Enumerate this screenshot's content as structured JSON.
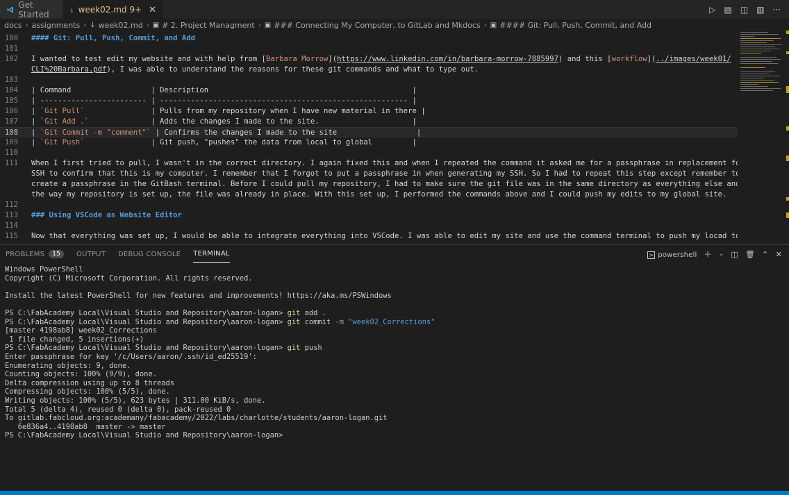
{
  "tabs": [
    {
      "label": "Get Started",
      "active": false,
      "icon": "vscode-icon"
    },
    {
      "label": "week02.md",
      "modified_marker": "9+",
      "active": true,
      "icon": "markdown-icon"
    }
  ],
  "breadcrumb": [
    {
      "label": "docs"
    },
    {
      "label": "assignments"
    },
    {
      "label": "week02.md",
      "icon": "markdown-icon"
    },
    {
      "label": "# 2. Project Managment",
      "icon": "symbol-icon"
    },
    {
      "label": "### Connecting My Computer, to GitLab and Mkdocs",
      "icon": "symbol-icon"
    },
    {
      "label": "#### Git: Pull, Push, Commit, and Add",
      "icon": "symbol-icon"
    }
  ],
  "editor": {
    "current_line": "108",
    "lines": [
      {
        "n": "100",
        "parts": [
          {
            "t": "#### Git: Pull, Push, Commit, and Add",
            "c": "heading"
          }
        ]
      },
      {
        "n": "101",
        "parts": []
      },
      {
        "n": "102",
        "parts": [
          {
            "t": "I wanted to test edit my website and with help from [",
            "c": ""
          },
          {
            "t": "Barbara Morrow",
            "c": "link-text"
          },
          {
            "t": "](",
            "c": ""
          },
          {
            "t": "https://www.linkedin.com/in/barbara-morrow-7885997",
            "c": "link-url"
          },
          {
            "t": ") and this [",
            "c": ""
          },
          {
            "t": "workflow",
            "c": "link-text"
          },
          {
            "t": "](",
            "c": ""
          },
          {
            "t": "../images/week01/",
            "c": "link-url"
          }
        ]
      },
      {
        "n": "",
        "parts": [
          {
            "t": "CLI%20Barbara.pdf",
            "c": "link-url"
          },
          {
            "t": "), I was able to understand the reasons for these git commands and what to type out.",
            "c": ""
          }
        ]
      },
      {
        "n": "103",
        "parts": []
      },
      {
        "n": "104",
        "parts": [
          {
            "t": "| Command                  | Description                                              |",
            "c": ""
          }
        ]
      },
      {
        "n": "105",
        "parts": [
          {
            "t": "| ------------------------ | -------------------------------------------------------- |",
            "c": ""
          }
        ]
      },
      {
        "n": "106",
        "parts": [
          {
            "t": "| ",
            "c": ""
          },
          {
            "t": "`Git Pull`",
            "c": "inline-code"
          },
          {
            "t": "               | Pulls from my repository when I have new material in there |",
            "c": ""
          }
        ]
      },
      {
        "n": "107",
        "parts": [
          {
            "t": "| ",
            "c": ""
          },
          {
            "t": "`Git Add .`",
            "c": "inline-code"
          },
          {
            "t": "              | Adds the changes I made to the site.                     |",
            "c": ""
          }
        ]
      },
      {
        "n": "108",
        "parts": [
          {
            "t": "| ",
            "c": ""
          },
          {
            "t": "`Git Commit -m \"comment\"`",
            "c": "inline-code"
          },
          {
            "t": " | Confirms the changes I made to the site                  |",
            "c": ""
          }
        ]
      },
      {
        "n": "109",
        "parts": [
          {
            "t": "| ",
            "c": ""
          },
          {
            "t": "`Git Push`",
            "c": "inline-code"
          },
          {
            "t": "               | Git push, \"pushes\" the data from local to global         |",
            "c": ""
          }
        ]
      },
      {
        "n": "110",
        "parts": []
      },
      {
        "n": "111",
        "parts": [
          {
            "t": "When I first tried to pull, I wasn't in the correct directory. I again fixed this and when I repeated the command it asked me for a passphrase in replacement for my",
            "c": ""
          }
        ]
      },
      {
        "n": "",
        "parts": [
          {
            "t": "SSH to confirm that this is my computer. I remember that I forgot to put a passphrase in when generating my SSH. So I had to repeat this step except remember to",
            "c": ""
          }
        ]
      },
      {
        "n": "",
        "parts": [
          {
            "t": "create a passphrase in the GitBash terminal. Before I could pull my repository, I had to make sure the git file was in the same directory as everything else and with",
            "c": ""
          }
        ]
      },
      {
        "n": "",
        "parts": [
          {
            "t": "the way my repository is set up, the file was already in place. With this set up, I performed the commands above and I could push my edits to my global site.",
            "c": ""
          }
        ]
      },
      {
        "n": "112",
        "parts": []
      },
      {
        "n": "113",
        "parts": [
          {
            "t": "### Using VSCode as Website Editor",
            "c": "heading"
          }
        ]
      },
      {
        "n": "114",
        "parts": []
      },
      {
        "n": "115",
        "parts": [
          {
            "t": "Now that everything was set up, I would be able to integrate everything into VSCode. I was able to edit my site and use the command terminal to push my locad to my",
            "c": ""
          }
        ]
      }
    ]
  },
  "panel": {
    "tabs": [
      {
        "label": "PROBLEMS",
        "badge": "15",
        "active": false
      },
      {
        "label": "OUTPUT",
        "active": false
      },
      {
        "label": "DEBUG CONSOLE",
        "active": false
      },
      {
        "label": "TERMINAL",
        "active": true
      }
    ],
    "shell_name": "powershell"
  },
  "terminal": {
    "lines": [
      [
        {
          "t": "Windows PowerShell",
          "c": ""
        }
      ],
      [
        {
          "t": "Copyright (C) Microsoft Corporation. All rights reserved.",
          "c": ""
        }
      ],
      [
        {
          "t": "",
          "c": ""
        }
      ],
      [
        {
          "t": "Install the latest PowerShell for new features and improvements! https://aka.ms/PSWindows",
          "c": ""
        }
      ],
      [
        {
          "t": "",
          "c": ""
        }
      ],
      [
        {
          "t": "PS C:\\FabAcademy Local\\Visual Studio and Repository\\aaron-logan> ",
          "c": ""
        },
        {
          "t": "git",
          "c": "cmd"
        },
        {
          "t": " add .",
          "c": ""
        }
      ],
      [
        {
          "t": "PS C:\\FabAcademy Local\\Visual Studio and Repository\\aaron-logan> ",
          "c": ""
        },
        {
          "t": "git",
          "c": "cmd"
        },
        {
          "t": " commit ",
          "c": ""
        },
        {
          "t": "-m",
          "c": "flag"
        },
        {
          "t": " ",
          "c": ""
        },
        {
          "t": "\"week02_Corrections\"",
          "c": "str"
        }
      ],
      [
        {
          "t": "[master 4198ab8] week02_Corrections",
          "c": ""
        }
      ],
      [
        {
          "t": " 1 file changed, 5 insertions(+)",
          "c": ""
        }
      ],
      [
        {
          "t": "PS C:\\FabAcademy Local\\Visual Studio and Repository\\aaron-logan> ",
          "c": ""
        },
        {
          "t": "git",
          "c": "cmd"
        },
        {
          "t": " push",
          "c": ""
        }
      ],
      [
        {
          "t": "Enter passphrase for key '/c/Users/aaron/.ssh/id_ed25519':",
          "c": ""
        }
      ],
      [
        {
          "t": "Enumerating objects: 9, done.",
          "c": ""
        }
      ],
      [
        {
          "t": "Counting objects: 100% (9/9), done.",
          "c": ""
        }
      ],
      [
        {
          "t": "Delta compression using up to 8 threads",
          "c": ""
        }
      ],
      [
        {
          "t": "Compressing objects: 100% (5/5), done.",
          "c": ""
        }
      ],
      [
        {
          "t": "Writing objects: 100% (5/5), 623 bytes | 311.00 KiB/s, done.",
          "c": ""
        }
      ],
      [
        {
          "t": "Total 5 (delta 4), reused 0 (delta 0), pack-reused 0",
          "c": ""
        }
      ],
      [
        {
          "t": "To gitlab.fabcloud.org:academany/fabacademy/2022/labs/charlotte/students/aaron-logan.git",
          "c": ""
        }
      ],
      [
        {
          "t": "   6e836a4..4198ab8  master -> master",
          "c": ""
        }
      ],
      [
        {
          "t": "PS C:\\FabAcademy Local\\Visual Studio and Repository\\aaron-logan>",
          "c": ""
        }
      ]
    ]
  },
  "colors": {
    "accent": "#007acc",
    "heading": "#569cd6",
    "string": "#ce9178",
    "command": "#dcdcaa"
  }
}
